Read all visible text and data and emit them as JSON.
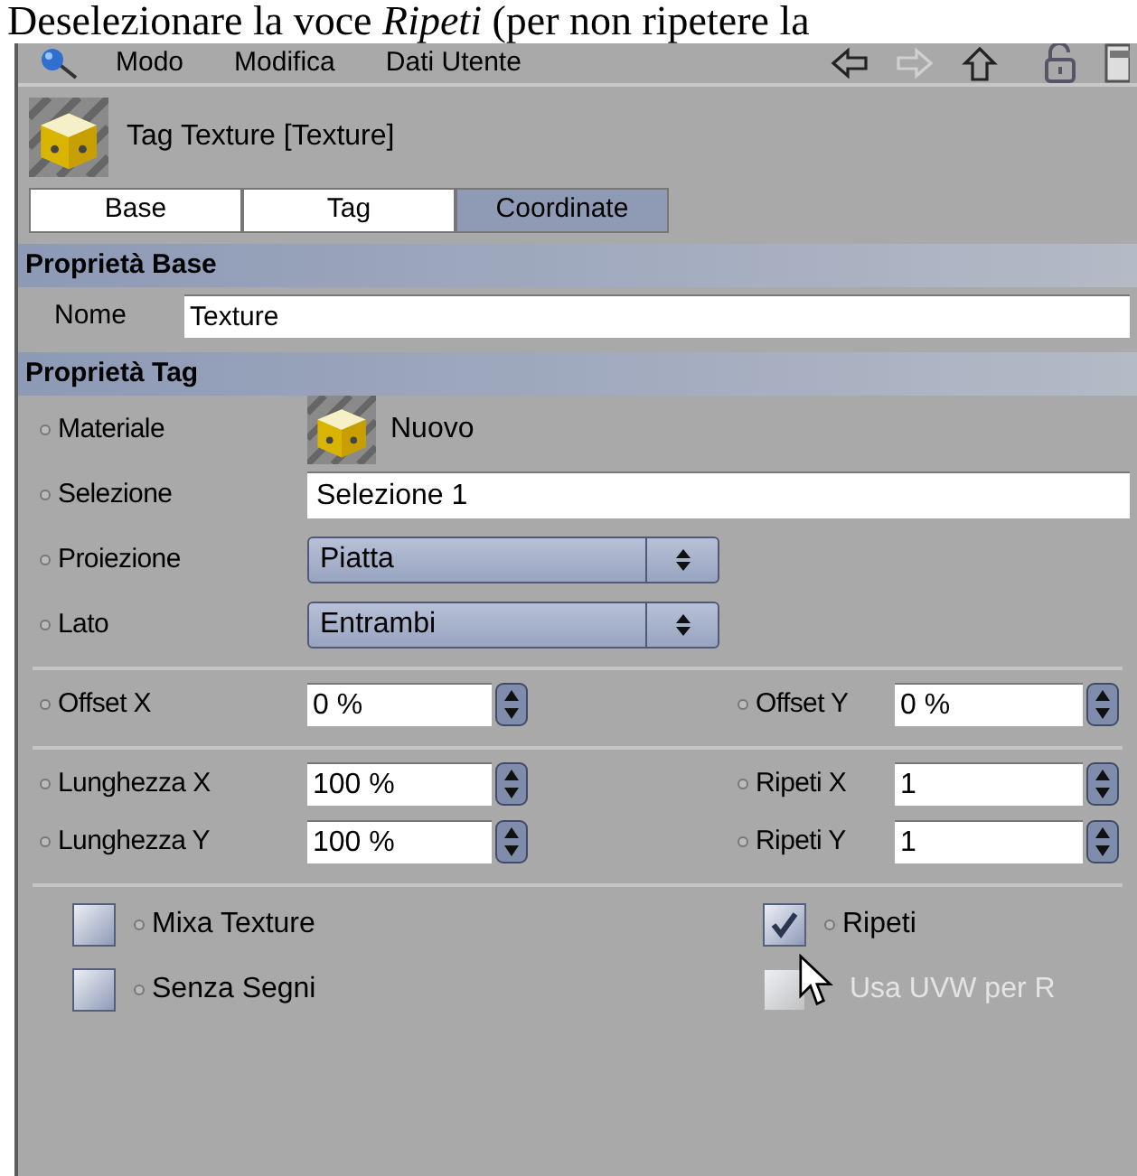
{
  "caption": "Deselezionare la voce *Ripeti* (per non ripetere la",
  "menu": [
    "Modo",
    "Modifica",
    "Dati Utente"
  ],
  "nav_buttons": [
    {
      "kind": "back",
      "disabled": false
    },
    {
      "kind": "forward",
      "disabled": true
    },
    {
      "kind": "up",
      "disabled": false
    }
  ],
  "object_title": "Tag Texture [Texture]",
  "tabs": [
    {
      "label": "Base",
      "selected": false
    },
    {
      "label": "Tag",
      "selected": false
    },
    {
      "label": "Coordinate",
      "selected": true
    }
  ],
  "base_section": {
    "title": "Proprietà Base",
    "name_label": "Nome",
    "name_value": "Texture"
  },
  "tag_section": {
    "title": "Proprietà Tag",
    "rows": [
      {
        "kind": "material",
        "label": "Materiale",
        "value": "Nuovo"
      },
      {
        "kind": "text",
        "label": "Selezione",
        "value": "Selezione 1"
      },
      {
        "kind": "dropdown",
        "label": "Proiezione",
        "value": "Piatta"
      },
      {
        "kind": "dropdown",
        "label": "Lato",
        "value": "Entrambi"
      }
    ],
    "numeric_groups": [
      {
        "rows": [
          {
            "left": {
              "label": "Offset X",
              "value": "0 %"
            },
            "right": {
              "label": "Offset Y",
              "value": "0 %"
            }
          }
        ]
      },
      {
        "rows": [
          {
            "left": {
              "label": "Lunghezza X",
              "value": "100 %"
            },
            "right": {
              "label": "Ripeti X",
              "value": "1"
            }
          },
          {
            "left": {
              "label": "Lunghezza Y",
              "value": "100 %"
            },
            "right": {
              "label": "Ripeti Y",
              "value": "1"
            }
          }
        ]
      }
    ],
    "checkboxes": [
      {
        "label": "Mixa Texture",
        "checked": false,
        "disabled": false
      },
      {
        "label": "Ripeti",
        "checked": true,
        "disabled": false
      },
      {
        "label": "Senza Segni",
        "checked": false,
        "disabled": false
      },
      {
        "label": "Usa UVW per R",
        "checked": false,
        "disabled": true
      }
    ]
  }
}
